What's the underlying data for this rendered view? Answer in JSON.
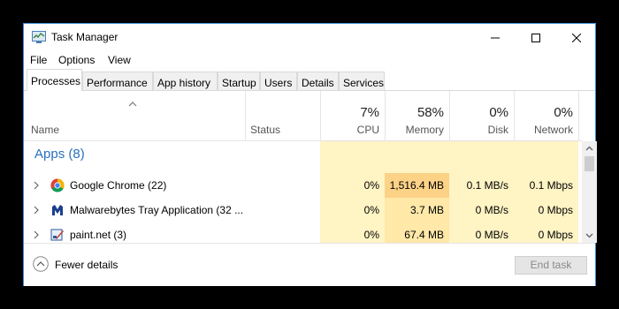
{
  "window": {
    "title": "Task Manager",
    "border_color": "#3c8fd8"
  },
  "menu": [
    "File",
    "Options",
    "View"
  ],
  "tabs": [
    {
      "label": "Processes",
      "active": true
    },
    {
      "label": "Performance"
    },
    {
      "label": "App history"
    },
    {
      "label": "Startup"
    },
    {
      "label": "Users"
    },
    {
      "label": "Details"
    },
    {
      "label": "Services"
    }
  ],
  "columns": {
    "name": "Name",
    "status": "Status",
    "cpu": {
      "pct": "7%",
      "label": "CPU"
    },
    "memory": {
      "pct": "58%",
      "label": "Memory"
    },
    "disk": {
      "pct": "0%",
      "label": "Disk"
    },
    "network": {
      "pct": "0%",
      "label": "Network"
    }
  },
  "groups": {
    "apps": "Apps (8)"
  },
  "processes": [
    {
      "name": "Google Chrome (22)",
      "icon": "chrome-icon",
      "cpu": "0%",
      "memory": "1,516.4 MB",
      "disk": "0.1 MB/s",
      "network": "0.1 Mbps"
    },
    {
      "name": "Malwarebytes Tray Application (32 ...",
      "icon": "malwarebytes-icon",
      "cpu": "0%",
      "memory": "3.7 MB",
      "disk": "0 MB/s",
      "network": "0 Mbps"
    },
    {
      "name": "paint.net (3)",
      "icon": "paint-net-icon",
      "cpu": "0%",
      "memory": "67.4 MB",
      "disk": "0 MB/s",
      "network": "0 Mbps"
    }
  ],
  "footer": {
    "fewer_details": "Fewer details",
    "end_task": "End task"
  },
  "colors": {
    "group_title": "#2a6fc0",
    "heat_low": "#fff4c4",
    "heat_mid": "#ffe8a8",
    "heat_high": "#fcd287"
  }
}
